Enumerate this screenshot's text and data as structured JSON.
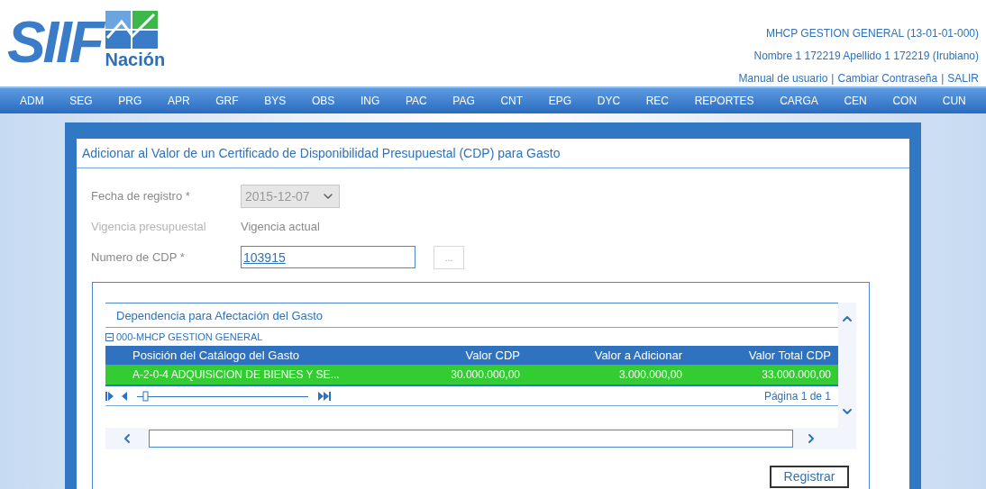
{
  "header": {
    "logo_text": "SIIF",
    "logo_subtext": "Nación",
    "entity": "MHCP GESTION GENERAL (13-01-01-000)",
    "user": "Nombre 1 172219 Apellido 1 172219 (Irubiano)",
    "separator": "|",
    "links": [
      {
        "label": "Manual de usuario"
      },
      {
        "label": "Cambiar Contraseña"
      },
      {
        "label": "SALIR"
      }
    ]
  },
  "nav": [
    "ADM",
    "SEG",
    "PRG",
    "APR",
    "GRF",
    "BYS",
    "OBS",
    "ING",
    "PAC",
    "PAG",
    "CNT",
    "EPG",
    "DYC",
    "REC",
    "REPORTES",
    "CARGA",
    "CEN",
    "CON",
    "CUN"
  ],
  "form": {
    "title": "Adicionar al Valor de un Certificado de Disponibilidad Presupuestal (CDP) para Gasto",
    "fields": [
      {
        "kind": "select",
        "label": "Fecha de registro *",
        "value": "2015-12-07",
        "disabled": true
      },
      {
        "kind": "text",
        "label": "Vigencia presupuestal",
        "value": "Vigencia actual"
      },
      {
        "kind": "input",
        "label": "Numero de CDP *",
        "value": "103915",
        "button": "..."
      }
    ]
  },
  "grid": {
    "section_title": "Dependencia para Afectación del Gasto",
    "group": {
      "label": "000-MHCP GESTION GENERAL",
      "expanded": true
    },
    "columns": [
      "Posición del Catálogo del Gasto",
      "Valor CDP",
      "Valor a Adicionar",
      "Valor Total CDP"
    ],
    "rows": [
      {
        "cells": [
          "A-2-0-4 ADQUISICION DE BIENES Y SE...",
          "30.000.000,00",
          "3.000.000,00",
          "33.000.000,00"
        ],
        "selected": true
      }
    ],
    "pager": "Página 1 de 1"
  },
  "submit": "Registrar"
}
